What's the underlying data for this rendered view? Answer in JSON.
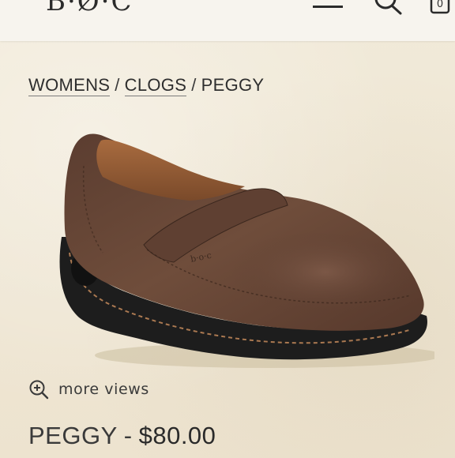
{
  "header": {
    "logo_text": "B·Ø·C",
    "cart_count": "0"
  },
  "breadcrumb": {
    "items": [
      "WOMENS",
      "CLOGS",
      "PEGGY"
    ],
    "separator": "/"
  },
  "product": {
    "image_alt": "Brown leather clog",
    "more_views_label": "more views",
    "name": "PEGGY",
    "title_separator": "-",
    "price": "$80.00"
  },
  "icons": {
    "menu": "hamburger-menu-icon",
    "search": "search-icon",
    "cart": "shopping-bag-icon",
    "zoom": "zoom-in-icon"
  },
  "colors": {
    "header_bg": "#f7f4ee",
    "page_bg": "#efe7d7",
    "text": "#3a3a3a",
    "shoe_leather": "#6b4a39",
    "sole": "#1e1e1e"
  }
}
